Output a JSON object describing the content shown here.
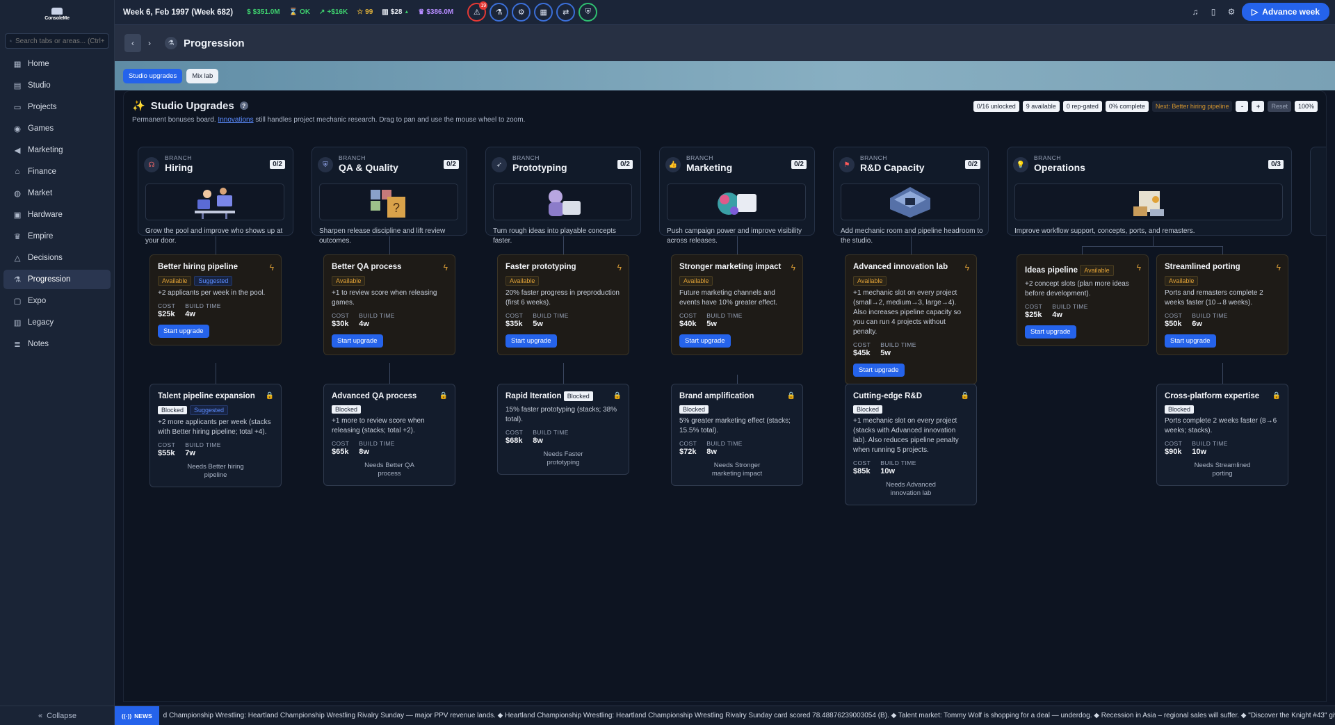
{
  "sidebar": {
    "logo_text": "ConsoleMe",
    "search_placeholder": "Search tabs or areas... (Ctrl+",
    "items": [
      {
        "label": "Home",
        "icon": "grid-icon"
      },
      {
        "label": "Studio",
        "icon": "building-icon"
      },
      {
        "label": "Projects",
        "icon": "folder-icon"
      },
      {
        "label": "Games",
        "icon": "gamepad-icon"
      },
      {
        "label": "Marketing",
        "icon": "megaphone-icon"
      },
      {
        "label": "Finance",
        "icon": "bank-icon"
      },
      {
        "label": "Market",
        "icon": "globe-icon"
      },
      {
        "label": "Hardware",
        "icon": "chip-icon"
      },
      {
        "label": "Empire",
        "icon": "crown-icon"
      },
      {
        "label": "Decisions",
        "icon": "alert-triangle-icon"
      },
      {
        "label": "Progression",
        "icon": "flask-icon"
      },
      {
        "label": "Expo",
        "icon": "monitor-icon"
      },
      {
        "label": "Legacy",
        "icon": "book-icon"
      },
      {
        "label": "Notes",
        "icon": "notes-icon"
      }
    ],
    "active": "Progression",
    "collapse_label": "Collapse"
  },
  "topbar": {
    "week": "Week 6, Feb 1997 (Week 682)",
    "cash": "$351.0M",
    "status": "OK",
    "trend": "+$16K",
    "stars": "99",
    "price": "$28",
    "valuation": "$386.0M",
    "alert_count": "19",
    "advance_label": "Advance week",
    "colors": {
      "cash": "#3ecf6e",
      "status": "#3ecf6e",
      "trend": "#3ecf6e",
      "stars": "#e0b23a",
      "price": "#e8ecf3",
      "valuation": "#b68cff",
      "accent": "#2563eb"
    }
  },
  "page": {
    "title": "Progression",
    "tabs": [
      "Studio upgrades",
      "Mix lab"
    ]
  },
  "board": {
    "title": "Studio Upgrades",
    "subtitle_before": "Permanent bonuses board.",
    "subtitle_link": "Innovations",
    "subtitle_after": "still handles project mechanic research. Drag to pan and use the mouse wheel to zoom.",
    "chips": {
      "unlocked": "0/16 unlocked",
      "available": "9 available",
      "rep_gated": "0 rep-gated",
      "complete": "0% complete",
      "next": "Next: Better hiring pipeline",
      "minus": "-",
      "plus": "+",
      "reset": "Reset",
      "zoom": "100%"
    }
  },
  "labels": {
    "branch": "BRANCH",
    "cost": "COST",
    "build_time": "BUILD TIME",
    "start": "Start upgrade",
    "available": "Available",
    "suggested": "Suggested",
    "blocked": "Blocked"
  },
  "branches": [
    {
      "name": "Hiring",
      "count": "0/2",
      "desc": "Grow the pool and improve who shows up at your door.",
      "icon": "headset-icon"
    },
    {
      "name": "QA & Quality",
      "count": "0/2",
      "desc": "Sharpen release discipline and lift review outcomes.",
      "icon": "shield-icon"
    },
    {
      "name": "Prototyping",
      "count": "0/2",
      "desc": "Turn rough ideas into playable concepts faster.",
      "icon": "rocket-icon"
    },
    {
      "name": "Marketing",
      "count": "0/2",
      "desc": "Push campaign power and improve visibility across releases.",
      "icon": "thumbs-up-icon"
    },
    {
      "name": "R&D Capacity",
      "count": "0/2",
      "desc": "Add mechanic room and pipeline headroom to the studio.",
      "icon": "lab-icon"
    },
    {
      "name": "Operations",
      "count": "0/3",
      "desc": "Improve workflow support, concepts, ports, and remasters.",
      "icon": "lightbulb-icon"
    }
  ],
  "cards": {
    "better_hiring": {
      "title": "Better hiring pipeline",
      "desc": "+2 applicants per week in the pool.",
      "cost": "$25k",
      "time": "4w"
    },
    "talent_pipeline": {
      "title": "Talent pipeline expansion",
      "desc": "+2 more applicants per week (stacks with Better hiring pipeline; total +4).",
      "cost": "$55k",
      "time": "7w",
      "needs": "Needs Better hiring pipeline"
    },
    "better_qa": {
      "title": "Better QA process",
      "desc": "+1 to review score when releasing games.",
      "cost": "$30k",
      "time": "4w"
    },
    "advanced_qa": {
      "title": "Advanced QA process",
      "desc": "+1 more to review score when releasing (stacks; total +2).",
      "cost": "$65k",
      "time": "8w",
      "needs": "Needs Better QA process"
    },
    "faster_proto": {
      "title": "Faster prototyping",
      "desc": "20% faster progress in preproduction (first 6 weeks).",
      "cost": "$35k",
      "time": "5w"
    },
    "rapid_iter": {
      "title": "Rapid Iteration",
      "desc": "15% faster prototyping (stacks; 38% total).",
      "cost": "$68k",
      "time": "8w",
      "needs": "Needs Faster prototyping"
    },
    "stronger_mkt": {
      "title": "Stronger marketing impact",
      "desc": "Future marketing channels and events have 10% greater effect.",
      "cost": "$40k",
      "time": "5w"
    },
    "brand_amp": {
      "title": "Brand amplification",
      "desc": "5% greater marketing effect (stacks; 15.5% total).",
      "cost": "$72k",
      "time": "8w",
      "needs": "Needs Stronger marketing impact"
    },
    "adv_innov": {
      "title": "Advanced innovation lab",
      "desc": "+1 mechanic slot on every project (small→2, medium→3, large→4). Also increases pipeline capacity so you can run 4 projects without penalty.",
      "cost": "$45k",
      "time": "5w"
    },
    "cutting_edge": {
      "title": "Cutting-edge R&D",
      "desc": "+1 mechanic slot on every project (stacks with Advanced innovation lab). Also reduces pipeline penalty when running 5 projects.",
      "cost": "$85k",
      "time": "10w",
      "needs": "Needs Advanced innovation lab"
    },
    "ideas_pipe": {
      "title": "Ideas pipeline",
      "desc": "+2 concept slots (plan more ideas before development).",
      "cost": "$25k",
      "time": "4w"
    },
    "stream_port": {
      "title": "Streamlined porting",
      "desc": "Ports and remasters complete 2 weeks faster (10→8 weeks).",
      "cost": "$50k",
      "time": "6w"
    },
    "cross_plat": {
      "title": "Cross-platform expertise",
      "desc": "Ports complete 2 weeks faster (8→6 weeks; stacks).",
      "cost": "$90k",
      "time": "10w",
      "needs": "Needs Streamlined porting"
    }
  },
  "ticker": {
    "label": "NEWS",
    "text": "d Championship Wrestling: Heartland Championship Wrestling Rivalry Sunday — major PPV revenue lands. ◆ Heartland Championship Wrestling: Heartland Championship Wrestling Rivalry Sunday card scored 78.48876239003054 (B). ◆ Talent market: Tommy Wolf is shopping for a deal — underdog. ◆ Recession in Asia – regional sales will suffer. ◆ \"Discover the Knight #43\" gives Third-Pa"
  }
}
